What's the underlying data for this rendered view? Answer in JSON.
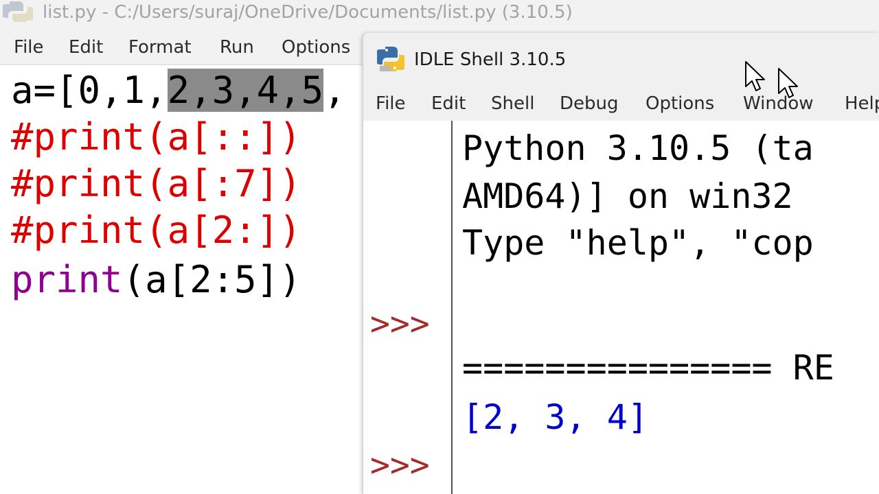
{
  "editor": {
    "title": "list.py - C:/Users/suraj/OneDrive/Documents/list.py (3.10.5)",
    "menu": [
      "File",
      "Edit",
      "Format",
      "Run",
      "Options"
    ],
    "code": {
      "line1_prefix": "a=[0,1,",
      "line1_selected": "2,3,4,5",
      "line1_suffix": ",",
      "line2": "#print(a[::])",
      "line3": "#print(a[:7])",
      "line4": "#print(a[2:])",
      "line5_keyword": "print",
      "line5_rest": "(a[2:5])"
    }
  },
  "shell": {
    "title": "IDLE Shell 3.10.5",
    "menu": [
      "File",
      "Edit",
      "Shell",
      "Debug",
      "Options",
      "Window",
      "Help"
    ],
    "prompt": ">>>",
    "banner_line1": "Python 3.10.5 (ta",
    "banner_line2": "AMD64)] on win32",
    "banner_line3": "Type \"help\", \"cop",
    "restart_line": "=============== RE",
    "output": "[2, 3, 4]"
  },
  "colors": {
    "comment": "#dd0000",
    "builtin": "#900090",
    "prompt": "#a52a2a",
    "output": "#0000cc",
    "selection": "#8a8a8a"
  },
  "icons": {
    "editor_app": "python-logo-icon",
    "shell_app": "python-logo-icon",
    "cursor": "mouse-pointer-icon"
  }
}
